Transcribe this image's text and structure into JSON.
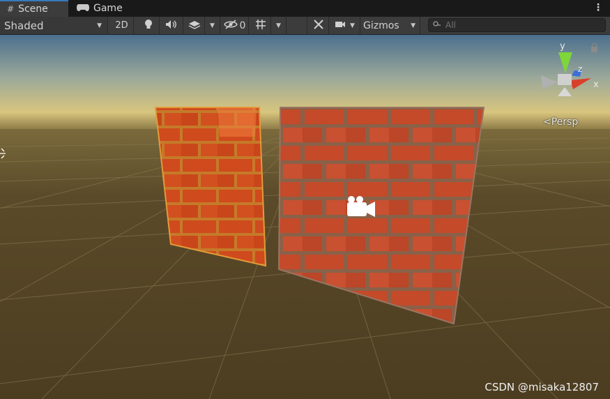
{
  "tabs": [
    {
      "icon": "grid-icon",
      "glyph": "#",
      "label": "Scene"
    },
    {
      "icon": "gamepad-icon",
      "glyph": "🎮",
      "label": "Game"
    }
  ],
  "toolbar": {
    "shading_mode": "Shaded",
    "mode_2d": "2D",
    "hidden_count": "0",
    "gizmos_label": "Gizmos",
    "search_placeholder": "All"
  },
  "viewport": {
    "projection": "Persp",
    "gizmo_axes": {
      "y": "y",
      "z": "z",
      "x": "x"
    },
    "watermark": "CSDN @misaka12807"
  },
  "colors": {
    "selected_tab_accent": "#3a79bb",
    "toolbar_bg": "#3c3c3c",
    "axis_x": "#d9402b",
    "axis_y": "#7fd63a",
    "axis_z": "#3d6fd8"
  }
}
